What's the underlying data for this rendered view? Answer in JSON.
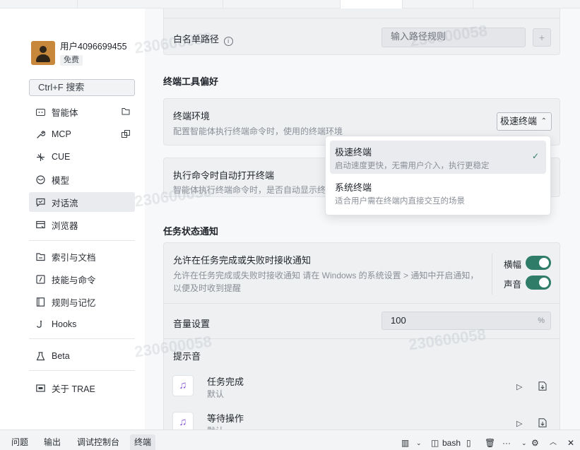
{
  "user": {
    "name": "用户4096699455",
    "plan": "免费"
  },
  "search": {
    "label": "Ctrl+F 搜索"
  },
  "nav": [
    {
      "label": "智能体",
      "icon": "agent-icon"
    },
    {
      "label": "MCP",
      "icon": "wrench-icon"
    },
    {
      "label": "CUE",
      "icon": "cue-icon"
    },
    {
      "label": "模型",
      "icon": "model-icon"
    },
    {
      "label": "对话流",
      "icon": "chat-flow-icon"
    },
    {
      "label": "浏览器",
      "icon": "browser-icon"
    },
    {
      "label": "索引与文档",
      "icon": "index-icon"
    },
    {
      "label": "技能与命令",
      "icon": "skill-icon"
    },
    {
      "label": "规则与记忆",
      "icon": "rules-icon"
    },
    {
      "label": "Hooks",
      "icon": "hook-icon"
    },
    {
      "label": "Beta",
      "icon": "beta-icon"
    },
    {
      "label": "关于 TRAE",
      "icon": "about-icon"
    }
  ],
  "whitelist": {
    "label": "白名单路径",
    "placeholder": "输入路径规则",
    "add": "+"
  },
  "terminal_prefs": {
    "section": "终端工具偏好",
    "env_title": "终端环境",
    "env_desc": "配置智能体执行终端命令时，使用的终端环境",
    "selected": "极速终端",
    "auto_open_title": "执行命令时自动打开终端",
    "auto_open_desc": "智能体执行终端命令时，是否自动显示终"
  },
  "dropdown": {
    "options": [
      {
        "title": "极速终端",
        "desc": "启动速度更快，无需用户介入，执行更稳定",
        "selected": true
      },
      {
        "title": "系统终端",
        "desc": "适合用户需在终端内直接交互的场景",
        "selected": false
      }
    ],
    "check": "✓"
  },
  "notify": {
    "section": "任务状态通知",
    "title": "允许在任务完成或失败时接收通知",
    "desc_line1": "允许在任务完成或失败时接收通知 请在 Windows 的系统设置 > 通知中开启通知，",
    "desc_line2": "以便及时收到提醒",
    "banner_label": "横幅",
    "banner_on": true,
    "sound_label": "声音",
    "sound_on": true,
    "volume_label": "音量设置",
    "volume_value": "100",
    "volume_unit": "%",
    "tone_label": "提示音",
    "tones": [
      {
        "title": "任务完成",
        "sub": "默认"
      },
      {
        "title": "等待操作",
        "sub": "默认"
      }
    ]
  },
  "watermark": "230600058",
  "statusbar": {
    "tabs": [
      "问题",
      "输出",
      "调试控制台",
      "终端"
    ],
    "active_tab": "终端",
    "shell": "bash",
    "more": "···"
  },
  "colors": {
    "accent": "#2f7d68",
    "avatar": "#c8883c",
    "music_icon": "#8a5cd8"
  }
}
